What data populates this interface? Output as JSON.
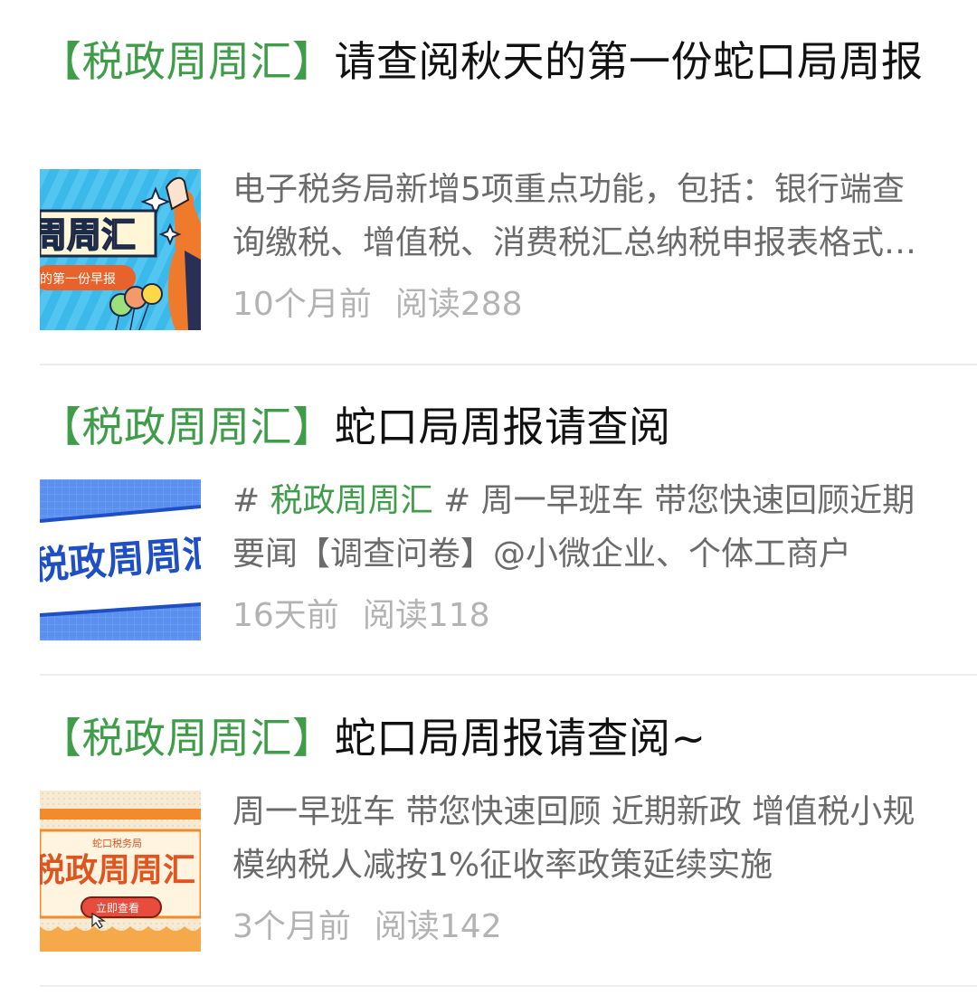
{
  "articles": [
    {
      "tag": "【税政周周汇】",
      "title_rest": "请查阅秋天的第一份蛇口局周报",
      "digest": "电子税务局新增5项重点功能，包括：银行端查询缴税、增值税、消费税汇总纳税申报表格式调整等",
      "time": "10个月前",
      "reads": "阅读288",
      "thumb": {
        "big_text": "周周汇",
        "ribbon_text": "的第一份早报"
      }
    },
    {
      "tag": "【税政周周汇】",
      "title_rest": "蛇口局周报请查阅",
      "digest_prefix": "# ",
      "digest_tag": "税政周周汇",
      "digest_rest": " # 周一早班车 带您快速回顾近期要闻【调查问卷】@小微企业、个体工商户",
      "time": "16天前",
      "reads": "阅读118",
      "thumb": {
        "big_text": "税政周周汇"
      }
    },
    {
      "tag": "【税政周周汇】",
      "title_rest": "蛇口局周报请查阅~",
      "digest": "周一早班车 带您快速回顾 近期新政 增值税小规模纳税人减按1%征收率政策延续实施",
      "time": "3个月前",
      "reads": "阅读142",
      "thumb": {
        "small_text": "蛇口税务局",
        "big_text": "税政周周汇",
        "button_text": "立即查看"
      }
    }
  ],
  "colors": {
    "tag_green": "#3f9d4a",
    "digest_gray": "#6b6b6b",
    "meta_gray": "#b3b3b3",
    "divider": "#ececec"
  }
}
